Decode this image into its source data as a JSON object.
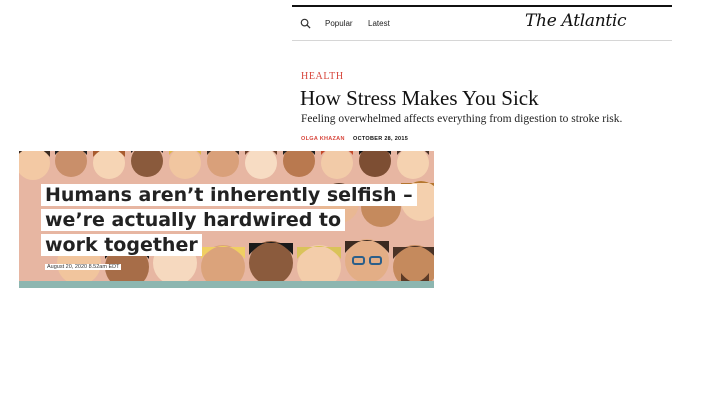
{
  "atlantic": {
    "nav": {
      "popular": "Popular",
      "latest": "Latest"
    },
    "logo": "The Atlantic",
    "section": "HEALTH",
    "headline": "How Stress Makes You Sick",
    "subhead": "Feeling overwhelmed affects everything from digestion to stroke risk.",
    "author": "OLGA KHAZAN",
    "date": "OCTOBER 28, 2015",
    "colors": {
      "accent": "#d7453b",
      "text": "#111111"
    }
  },
  "conversation": {
    "headline_lines": [
      "Humans aren’t inherently selfish –",
      "we’re actually hardwired to",
      "work together"
    ],
    "timestamp": "August 20, 2020 8.52am EDT",
    "illustration": "crowd-of-diverse-faces"
  }
}
